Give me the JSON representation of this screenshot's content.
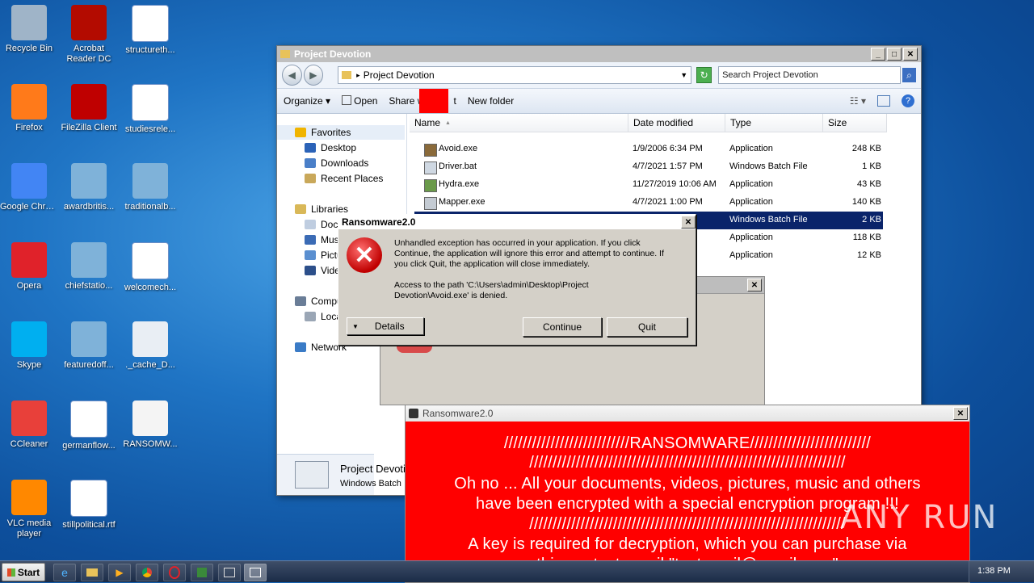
{
  "desktop": {
    "icons": [
      {
        "label": "Recycle Bin",
        "icon": "recycle-bin-icon"
      },
      {
        "label": "Acrobat Reader DC",
        "icon": "acrobat-icon"
      },
      {
        "label": "structureth...",
        "icon": "word-doc-icon"
      },
      {
        "label": "Firefox",
        "icon": "firefox-icon"
      },
      {
        "label": "FileZilla Client",
        "icon": "filezilla-icon"
      },
      {
        "label": "studiesrele...",
        "icon": "word-doc-icon"
      },
      {
        "label": "Google Chrome",
        "icon": "chrome-icon"
      },
      {
        "label": "awardbritis...",
        "icon": "image-icon"
      },
      {
        "label": "traditionalb...",
        "icon": "image-icon"
      },
      {
        "label": "Opera",
        "icon": "opera-icon"
      },
      {
        "label": "chiefstatio...",
        "icon": "image-icon"
      },
      {
        "label": "welcomech...",
        "icon": "word-doc-icon"
      },
      {
        "label": "Skype",
        "icon": "skype-icon"
      },
      {
        "label": "featuredoff...",
        "icon": "image-icon"
      },
      {
        "label": "._cache_D...",
        "icon": "app-icon"
      },
      {
        "label": "CCleaner",
        "icon": "ccleaner-icon"
      },
      {
        "label": "germanflow...",
        "icon": "word-doc-icon"
      },
      {
        "label": "RANSOMW...",
        "icon": "text-file-icon"
      },
      {
        "label": "VLC media player",
        "icon": "vlc-icon"
      },
      {
        "label": "stillpolitical.rtf",
        "icon": "word-doc-icon"
      }
    ]
  },
  "explorer": {
    "title": "Project Devotion",
    "address": "Project Devotion",
    "search_placeholder": "Search Project Devotion",
    "toolbar": {
      "organize": "Organize",
      "open": "Open",
      "share_with": "Share with",
      "print": "t",
      "new_folder": "New folder"
    },
    "sidebar": {
      "favorites": "Favorites",
      "desktop": "Desktop",
      "downloads": "Downloads",
      "recent": "Recent Places",
      "libraries": "Libraries",
      "documents": "Docu",
      "music": "Musi",
      "pictures": "Pictu",
      "videos": "Vide",
      "computer": "Compu",
      "local": "Loca",
      "network": "Network"
    },
    "columns": {
      "name": "Name",
      "date": "Date modified",
      "type": "Type",
      "size": "Size"
    },
    "files": [
      {
        "name": "Avoid.exe",
        "date": "1/9/2006 6:34 PM",
        "type": "Application",
        "size": "248 KB"
      },
      {
        "name": "Driver.bat",
        "date": "4/7/2021 1:57 PM",
        "type": "Windows Batch File",
        "size": "1 KB"
      },
      {
        "name": "Hydra.exe",
        "date": "11/27/2019 10:06 AM",
        "type": "Application",
        "size": "43 KB"
      },
      {
        "name": "Mapper.exe",
        "date": "4/7/2021 1:00 PM",
        "type": "Application",
        "size": "140 KB"
      },
      {
        "name": "",
        "date": "M",
        "type": "Windows Batch File",
        "size": "2 KB"
      },
      {
        "name": "",
        "date": "PM",
        "type": "Application",
        "size": "118 KB"
      },
      {
        "name": "",
        "date": "PM",
        "type": "Application",
        "size": "12 KB"
      }
    ],
    "details_name": "Project Devoti",
    "details_type": "Windows Batch"
  },
  "error_dialog": {
    "title": "Ransomware2.0",
    "message1": "Unhandled exception has occurred in your application. If you click Continue, the application will ignore this error and attempt to continue. If you click Quit, the application will close immediately.",
    "message2": "Access to the path 'C:\\Users\\admin\\Desktop\\Project Devotion\\Avoid.exe' is denied.",
    "details_label": "Details",
    "continue_label": "Continue",
    "quit_label": "Quit"
  },
  "ransom_window": {
    "title": "Ransomware2.0",
    "line1": "///////////////////////////RANSOMWARE//////////////////////////",
    "line2": "////////////////////////////////////////////////////////////////////",
    "line3": "Oh no ... All your documents, videos, pictures, music and others",
    "line4": "have been encrypted with a special encryption program !!!",
    "line5": "////////////////////////////////////////////////////////////////////",
    "line6": "A key is required for decryption, which you can purchase via",
    "line7": "this contact email \"testemail@gmail.com\""
  },
  "taskbar": {
    "start_label": "Start",
    "clock": "1:38 PM"
  },
  "watermark": "ANY RUN"
}
